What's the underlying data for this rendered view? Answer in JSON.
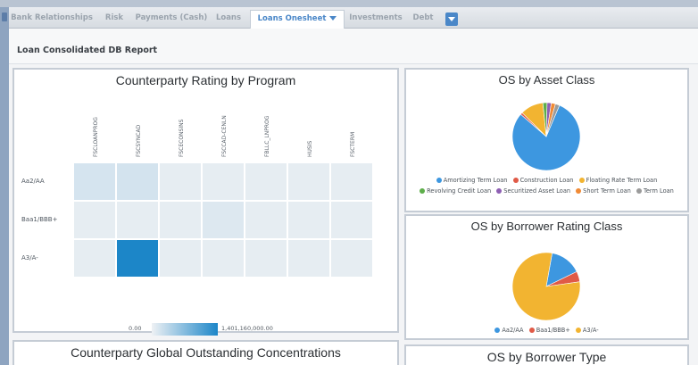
{
  "nav": {
    "tabs": [
      {
        "label": "Bank Relationships"
      },
      {
        "label": "Risk"
      },
      {
        "label": "Payments (Cash)"
      },
      {
        "label": "Loans"
      },
      {
        "label": "Loans Onesheet"
      },
      {
        "label": "Investments"
      },
      {
        "label": "Debt"
      }
    ],
    "active_tab": "Loans Onesheet",
    "accent_color": "#4a87c8"
  },
  "page": {
    "title": "Loan Consolidated DB Report"
  },
  "heatmap_panel": {
    "title": "Counterparty Rating by Program",
    "scale_min": "0.00",
    "scale_max": "1,401,160,000.00"
  },
  "asset_panel": {
    "title": "OS by Asset Class",
    "legend": [
      {
        "label": "Amortizing Term Loan",
        "color": "#3d97e0"
      },
      {
        "label": "Construction Loan",
        "color": "#e05a47"
      },
      {
        "label": "Floating Rate Term Loan",
        "color": "#f2b431"
      },
      {
        "label": "Revolving Credit Loan",
        "color": "#5dae4a"
      },
      {
        "label": "Securitized Asset Loan",
        "color": "#8e5fb3"
      },
      {
        "label": "Short Term Loan",
        "color": "#f08a35"
      },
      {
        "label": "Term Loan",
        "color": "#9b9b9b"
      }
    ]
  },
  "borrower_panel": {
    "title": "OS by Borrower Rating Class",
    "legend": [
      {
        "label": "Aa2/AA",
        "color": "#3d97e0"
      },
      {
        "label": "Baa1/BBB+",
        "color": "#e05a47"
      },
      {
        "label": "A3/A-",
        "color": "#f2b431"
      }
    ]
  },
  "bottom_left_panel": {
    "title": "Counterparty Global Outstanding Concentrations"
  },
  "bottom_right_panel": {
    "title": "OS by Borrower Type"
  },
  "chart_data": [
    {
      "type": "heatmap",
      "title": "Counterparty Rating by Program",
      "columns": [
        "FSCLOANPROG",
        "FSCSYNCAD",
        "FSCECONSINS",
        "FSCCAD-CENLN",
        "FBLLC_LNPROG",
        "HUSIS",
        "FSCTERM"
      ],
      "rows": [
        "Aa2/AA",
        "Baa1/BBB+",
        "A3/A-"
      ],
      "values": [
        [
          0.12,
          0.13,
          0.04,
          0.04,
          0.04,
          0.04,
          0.04
        ],
        [
          0.04,
          0.04,
          0.04,
          0.08,
          0.04,
          0.04,
          0.04
        ],
        [
          0.04,
          1.0,
          0.04,
          0.04,
          0.04,
          0.04,
          0.04
        ]
      ],
      "scale": {
        "min": 0.0,
        "max": 1401160000.0
      }
    },
    {
      "type": "pie",
      "title": "OS by Asset Class",
      "labels": [
        "Amortizing Term Loan",
        "Construction Loan",
        "Floating Rate Term Loan",
        "Revolving Credit Loan",
        "Securitized Asset Loan",
        "Short Term Loan",
        "Term Loan"
      ],
      "values": [
        80,
        1,
        11,
        2,
        2,
        2,
        2
      ]
    },
    {
      "type": "pie",
      "title": "OS by Borrower Rating Class",
      "labels": [
        "Aa2/AA",
        "Baa1/BBB+",
        "A3/A-"
      ],
      "values": [
        15,
        5,
        80
      ]
    }
  ]
}
